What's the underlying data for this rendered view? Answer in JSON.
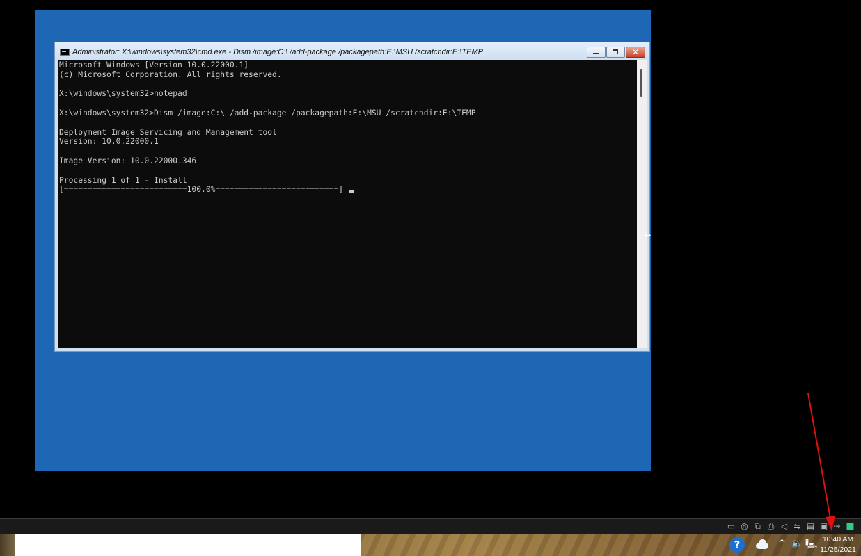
{
  "window": {
    "title": "Administrator: X:\\windows\\system32\\cmd.exe - Dism  /image:C:\\ /add-package /packagepath:E:\\MSU /scratchdir:E:\\TEMP",
    "minimize_icon": "minimize-icon",
    "maximize_icon": "maximize-icon",
    "close_glyph": "✕"
  },
  "console": {
    "lines": [
      "Microsoft Windows [Version 10.0.22000.1]",
      "(c) Microsoft Corporation. All rights reserved.",
      "",
      "X:\\windows\\system32>notepad",
      "",
      "X:\\windows\\system32>Dism /image:C:\\ /add-package /packagepath:E:\\MSU /scratchdir:E:\\TEMP",
      "",
      "Deployment Image Servicing and Management tool",
      "Version: 10.0.22000.1",
      "",
      "Image Version: 10.0.22000.346",
      "",
      "Processing 1 of 1 - Install",
      "[==========================100.0%==========================]"
    ]
  },
  "vm_tray": {
    "icons": [
      "hard-disk-icon",
      "optical-drive-icon",
      "network-adapter-icon",
      "printer-icon",
      "sound-icon",
      "usb-icon",
      "shared-folder-icon",
      "display-icon",
      "recording-icon",
      "message-icon"
    ]
  },
  "taskbar": {
    "help_glyph": "?",
    "chevron_glyph": "^",
    "speaker_glyph": "🔈",
    "network_glyph": "🖳",
    "time": "10:40 AM",
    "date": "11/25/2021"
  },
  "colors": {
    "vm_background": "#1d67b5",
    "console_background": "#0c0c0c",
    "console_text": "#cccccc",
    "annotation_arrow": "#e01010"
  }
}
